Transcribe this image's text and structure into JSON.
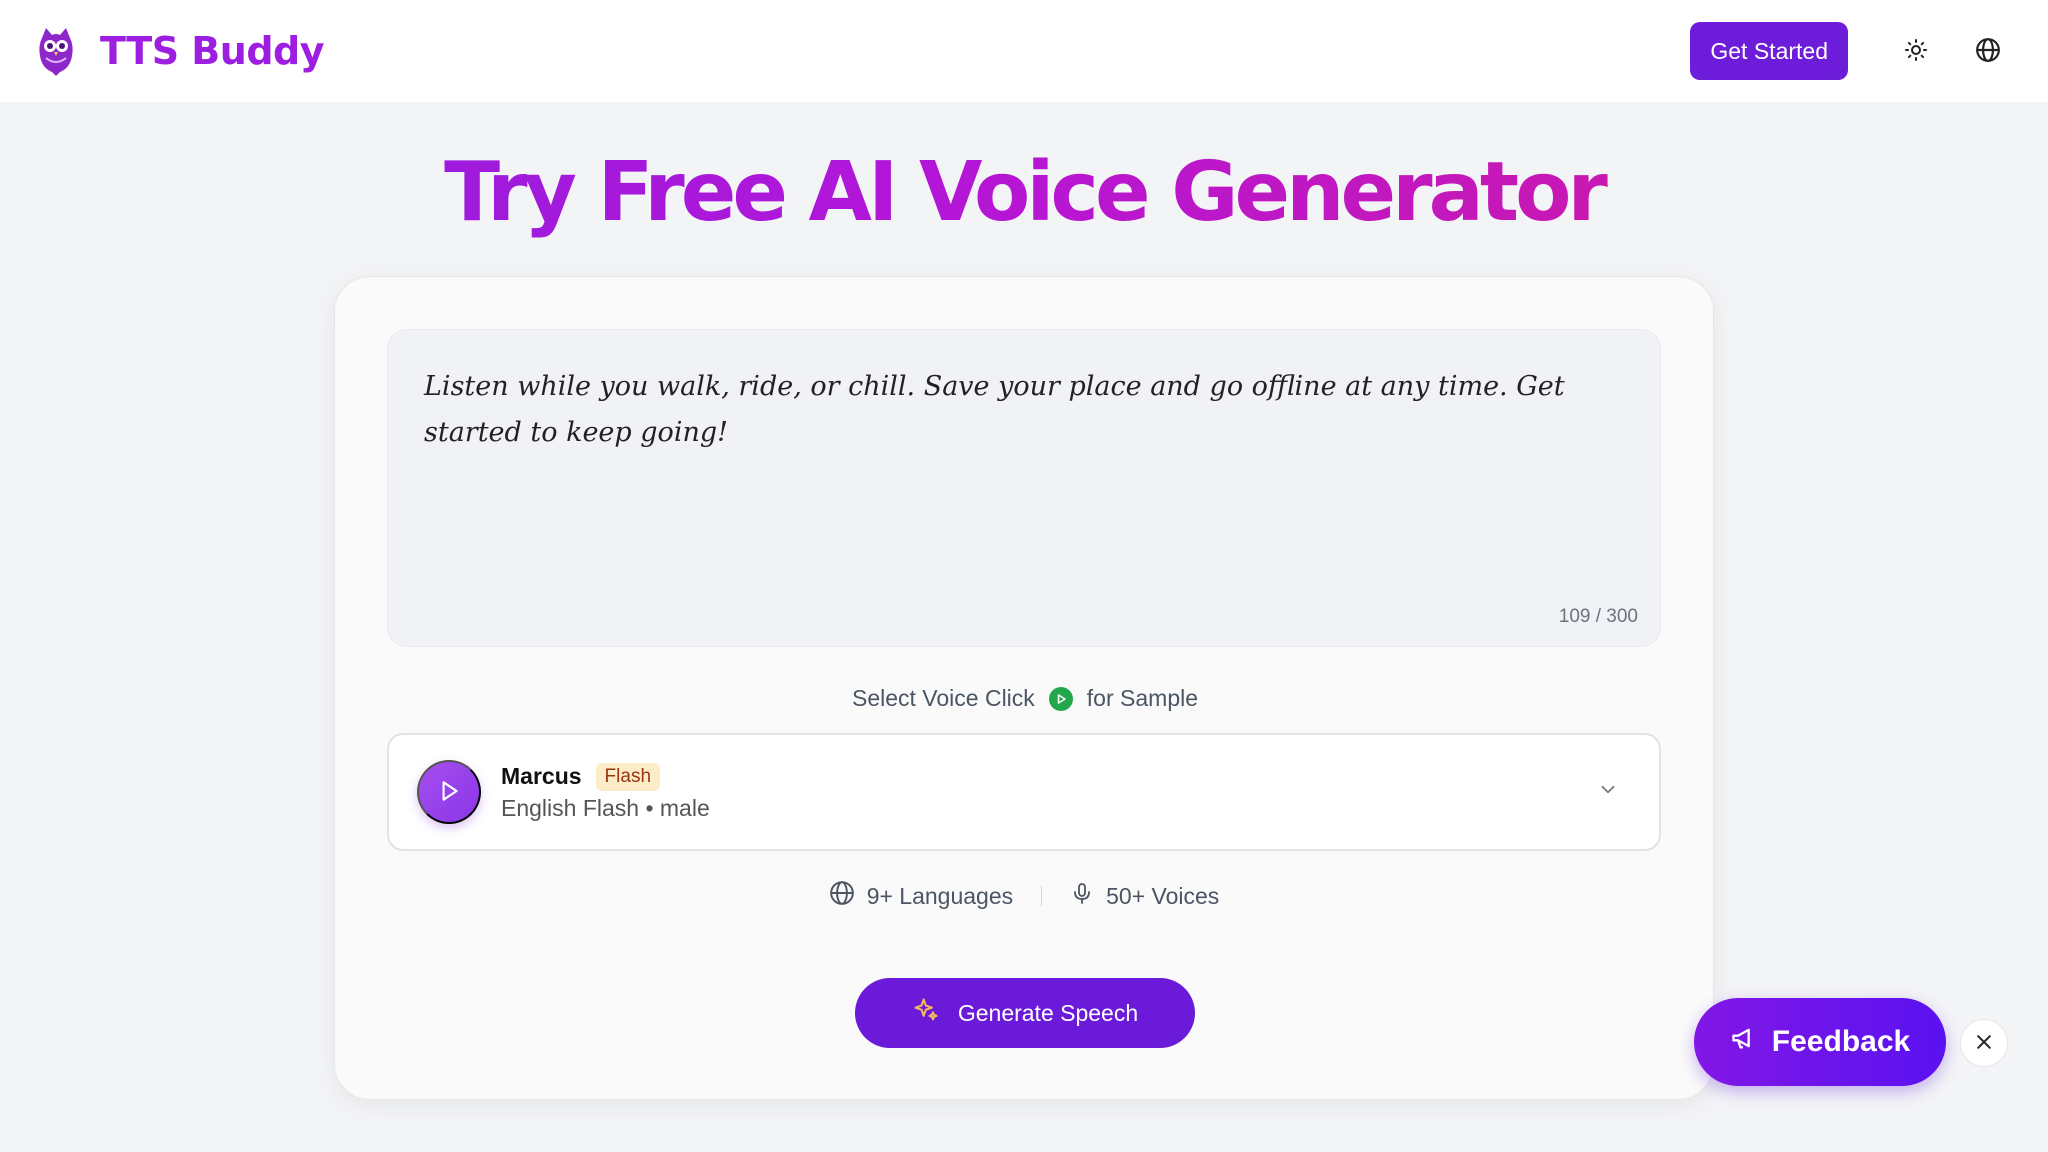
{
  "header": {
    "brand_name": "TTS Buddy",
    "get_started_label": "Get Started",
    "theme_icon": "sun-icon",
    "language_icon": "globe-icon"
  },
  "page_title": "Try Free AI Voice Generator",
  "editor": {
    "text": "Listen while you walk, ride, or chill. Save your place and go offline at any time. Get started to keep going!",
    "counter": "109 / 300"
  },
  "voice_hint": {
    "before": "Select Voice Click",
    "after": "for Sample"
  },
  "voice": {
    "name": "Marcus",
    "badge": "Flash",
    "subtitle": "English Flash • male"
  },
  "stats": {
    "languages": "9+ Languages",
    "voices": "50+ Voices"
  },
  "generate_label": "Generate Speech",
  "feedback_label": "Feedback",
  "colors": {
    "brand": "#9d1ee0",
    "primary": "#6d1cd9",
    "sample_play": "#22a74a",
    "badge_bg": "#fdecc8"
  }
}
